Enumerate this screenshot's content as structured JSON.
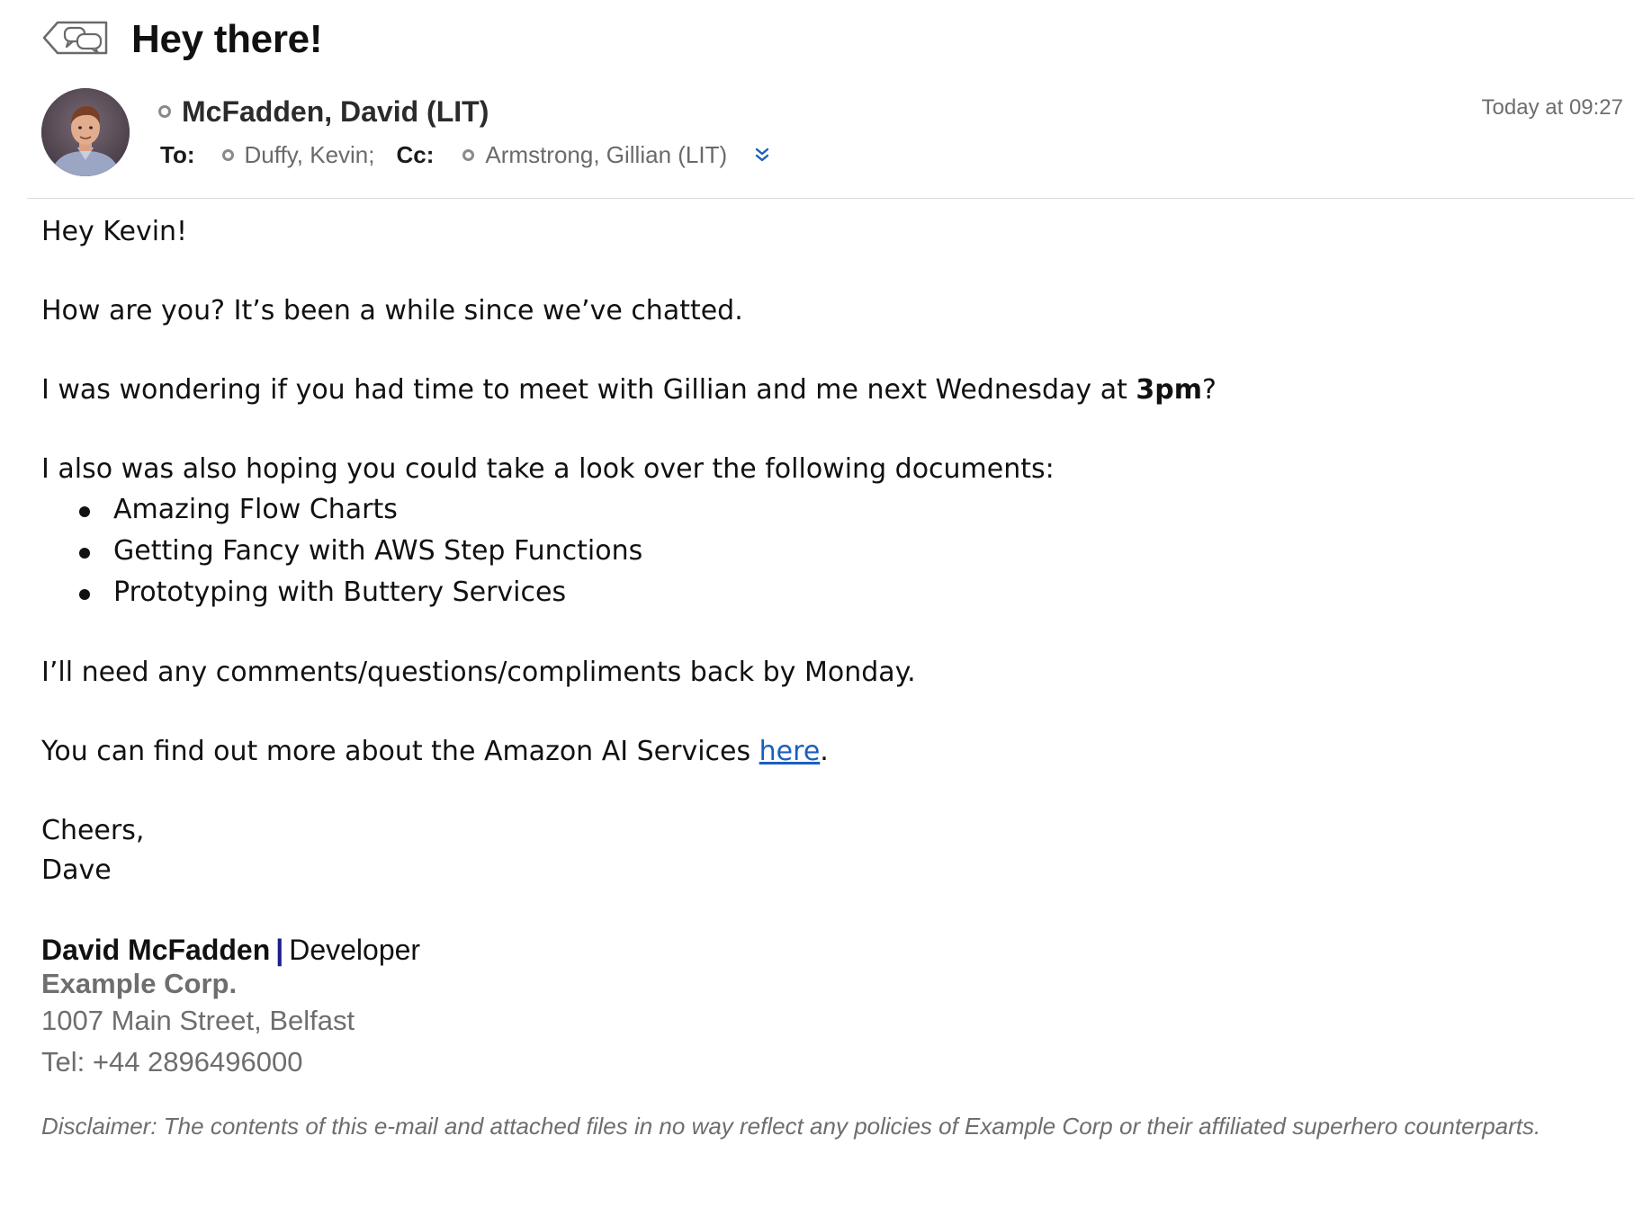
{
  "header": {
    "subject": "Hey there!",
    "sender_name": "McFadden, David (LIT)",
    "timestamp": "Today at 09:27",
    "to_label": "To:",
    "cc_label": "Cc:",
    "to_recipients": [
      "Duffy, Kevin;"
    ],
    "cc_recipients": [
      "Armstrong, Gillian (LIT)"
    ],
    "icons": {
      "conversation": "conversation-back-icon",
      "expand": "chevron-double-down-icon",
      "presence": "presence-offline-icon"
    },
    "colors": {
      "accent": "#1a5fbf",
      "muted": "#6e6e6e"
    }
  },
  "body": {
    "greeting": "Hey Kevin!",
    "para1": "How are you? It’s been a while since we’ve chatted.",
    "para2_before": "I was wondering if you had time to meet with Gillian and me next Wednesday at ",
    "para2_bold": "3pm",
    "para2_after": "?",
    "para3": "I also was also hoping you could take a look over the following documents:",
    "documents": [
      "Amazing Flow Charts",
      "Getting Fancy with AWS Step Functions",
      "Prototyping with Buttery Services"
    ],
    "para4": "I’ll need any comments/questions/compliments back by Monday.",
    "para5_before": "You can find out more about the Amazon AI Services ",
    "para5_link": "here",
    "para5_after": ".",
    "closing": "Cheers,",
    "closing_name": "Dave"
  },
  "signature": {
    "name": "David McFadden",
    "separator": "|",
    "role": "Developer",
    "company": "Example Corp.",
    "address": "1007 Main Street, Belfast",
    "tel": "Tel: +44 2896496000"
  },
  "disclaimer": "Disclaimer: The contents of this e-mail and attached files in no way reflect any policies of Example Corp or their affiliated superhero counterparts."
}
